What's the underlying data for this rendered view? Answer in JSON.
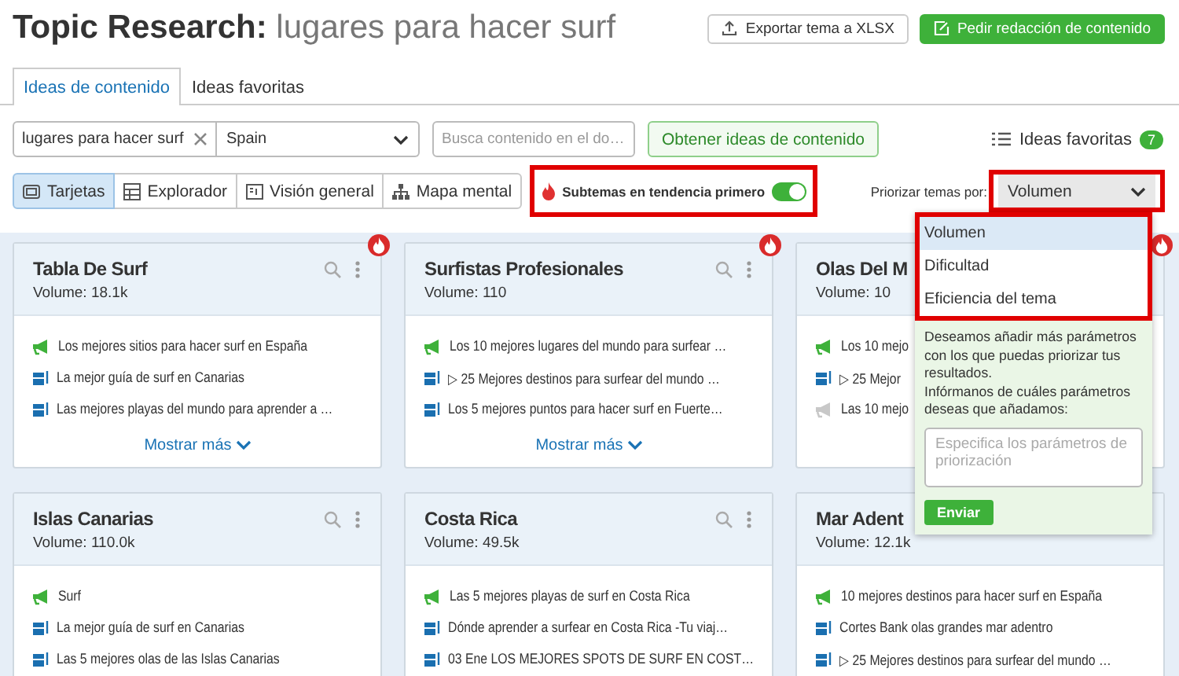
{
  "header": {
    "title": "Topic Research:",
    "topic": "lugares para hacer surf",
    "buttons": [
      {
        "kind": "export",
        "label": "Exportar tema a XLSX"
      },
      {
        "kind": "order",
        "label": "Pedir redacción de contenido"
      }
    ]
  },
  "tabs": [
    {
      "label": "Ideas de contenido",
      "selected": true
    },
    {
      "label": "Ideas favoritas",
      "selected": false
    }
  ],
  "search": {
    "query": "lugares para hacer surf",
    "country": "Spain",
    "content_search": {
      "placeholder": "Busca contenido en el do…"
    },
    "submit": "Obtener ideas de contenido",
    "favorites": {
      "label": "Ideas favoritas",
      "count": "7"
    }
  },
  "views": [
    {
      "kind": "cards",
      "label": "Tarjetas",
      "selected": true
    },
    {
      "kind": "table",
      "label": "Explorador",
      "selected": false
    },
    {
      "kind": "overview",
      "label": "Visión general",
      "selected": false
    },
    {
      "kind": "mindmap",
      "label": "Mapa mental",
      "selected": false
    }
  ],
  "trending_toggle": {
    "label": "Subtemas en tendencia primero",
    "on": true,
    "highlighted": true
  },
  "prioritize": {
    "label": "Priorizar temas por:",
    "value": "Volumen",
    "expanded": true,
    "highlighted": true,
    "options": [
      {
        "label": "Volumen",
        "selected": true
      },
      {
        "label": "Dificultad",
        "selected": false
      },
      {
        "label": "Eficiencia del tema",
        "selected": false
      }
    ],
    "feedback": {
      "paragraphs": [
        "Deseamos añadir más parámetros con los que puedas priorizar tus resultados.",
        "Infórmanos de cuáles parámetros deseas que añadamos:"
      ],
      "placeholder": "Especifica los parámetros de priorización",
      "button": "Enviar"
    }
  },
  "cards": [
    {
      "title": "Tabla De Surf",
      "volume": "Volume:  18.1k",
      "trending": true,
      "icons": true,
      "items": [
        {
          "kind": "headline",
          "text": "Los mejores sitios para hacer surf en España"
        },
        {
          "kind": "article",
          "text": "La mejor guía de surf en Canarias"
        },
        {
          "kind": "article",
          "text": "Las mejores playas del mundo para aprender a …"
        }
      ],
      "more": "Mostrar más"
    },
    {
      "title": "Surfistas Profesionales",
      "volume": "Volume:  110",
      "trending": true,
      "icons": true,
      "items": [
        {
          "kind": "headline",
          "text": "Los 10 mejores lugares del mundo para surfear …"
        },
        {
          "kind": "article",
          "text": "▷ 25 Mejores destinos para surfear del mundo …"
        },
        {
          "kind": "article",
          "text": "Los 5 mejores puntos para hacer surf en Fuerte…"
        }
      ],
      "more": "Mostrar más"
    },
    {
      "title": "Olas Del M",
      "volume": "Volume:  10",
      "trending": true,
      "icons": false,
      "items": [
        {
          "kind": "headline",
          "text": "Los 10 mejo"
        },
        {
          "kind": "article",
          "text": "▷ 25 Mejor"
        },
        {
          "kind": "inactive",
          "text": "Las 10 mejo"
        }
      ]
    },
    {
      "title": "Islas Canarias",
      "volume": "Volume:  110.0k",
      "trending": false,
      "icons": true,
      "items": [
        {
          "kind": "headline",
          "text": "Surf"
        },
        {
          "kind": "article",
          "text": "La mejor guía de surf en Canarias"
        },
        {
          "kind": "article",
          "text": "Las 5 mejores olas de las Islas Canarias"
        }
      ]
    },
    {
      "title": "Costa Rica",
      "volume": "Volume:  49.5k",
      "trending": false,
      "icons": true,
      "items": [
        {
          "kind": "headline",
          "text": "Las 5 mejores playas de surf en Costa Rica"
        },
        {
          "kind": "article",
          "text": "Dónde aprender a surfear en Costa Rica -Tu viaj…"
        },
        {
          "kind": "article",
          "text": "03 Ene LOS MEJORES SPOTS DE SURF EN COST…"
        }
      ]
    },
    {
      "title": "Mar Adent",
      "volume": "Volume:  12.1k",
      "trending": false,
      "icons": false,
      "items": [
        {
          "kind": "headline",
          "text": "10 mejores destinos para hacer surf en España"
        },
        {
          "kind": "article",
          "text": "Cortes Bank olas grandes mar adentro"
        },
        {
          "kind": "article",
          "text": "▷ 25 Mejores destinos para surfear del mundo …"
        }
      ]
    }
  ]
}
